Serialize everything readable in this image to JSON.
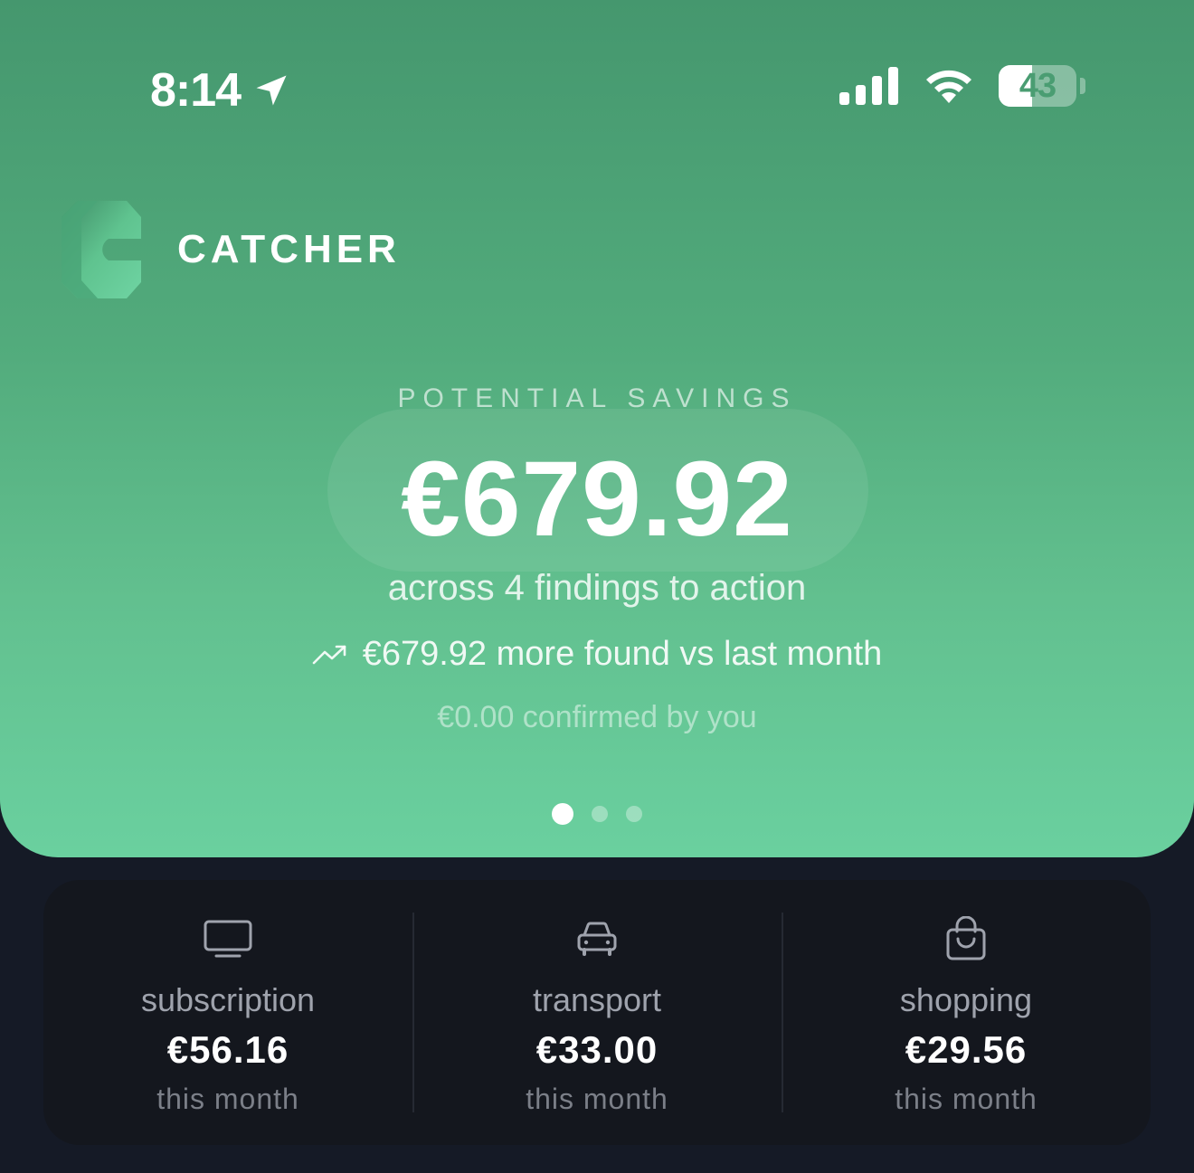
{
  "status": {
    "time": "8:14",
    "battery_level": "43",
    "battery_fraction": 0.43
  },
  "brand": {
    "name": "CATCHER"
  },
  "savings": {
    "label": "POTENTIAL SAVINGS",
    "amount": "€679.92",
    "findings_text": "across 4 findings to action",
    "trend_text": "€679.92 more found vs last month",
    "confirmed_text": "€0.00 confirmed by you"
  },
  "pager": {
    "count": 3,
    "active_index": 0
  },
  "categories": [
    {
      "icon": "tv-icon",
      "name": "subscription",
      "value": "€56.16",
      "period": "this month"
    },
    {
      "icon": "car-icon",
      "name": "transport",
      "value": "€33.00",
      "period": "this month"
    },
    {
      "icon": "shopping-bag-icon",
      "name": "shopping",
      "value": "€29.56",
      "period": "this month"
    }
  ],
  "colors": {
    "hero_top": "#45976e",
    "hero_bottom": "#6ad09f",
    "background": "#151a26",
    "card": "#14171e"
  }
}
